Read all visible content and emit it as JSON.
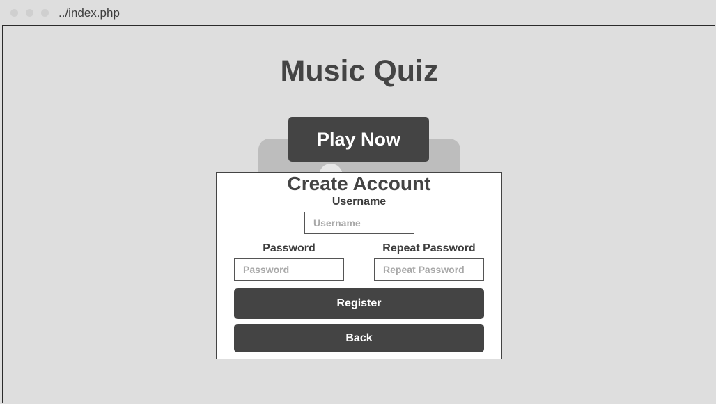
{
  "browser": {
    "url": "../index.php"
  },
  "page": {
    "title": "Music Quiz",
    "play_button_label": "Play Now"
  },
  "register_form": {
    "title": "Create Account",
    "username": {
      "label": "Username",
      "placeholder": "Username",
      "value": ""
    },
    "password": {
      "label": "Password",
      "placeholder": "Password",
      "value": ""
    },
    "repeat_password": {
      "label": "Repeat Password",
      "placeholder": "Repeat Password",
      "value": ""
    },
    "register_label": "Register",
    "back_label": "Back"
  },
  "colors": {
    "background": "#dedede",
    "primary": "#444444",
    "text": "#3d3d3d",
    "panel": "#ffffff"
  }
}
